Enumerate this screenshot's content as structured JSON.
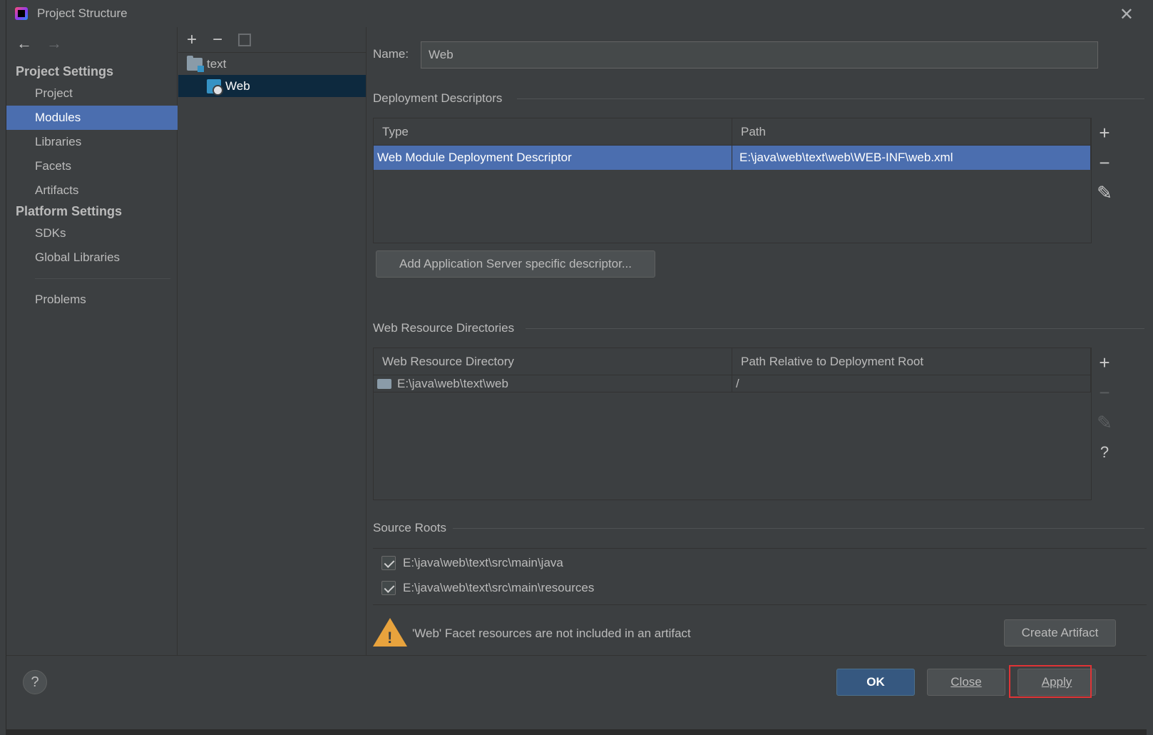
{
  "window": {
    "title": "Project Structure",
    "close_glyph": "✕"
  },
  "nav": {
    "back_glyph": "←",
    "forward_glyph": "→"
  },
  "sidebar": {
    "project_settings_header": "Project Settings",
    "project_items": [
      "Project",
      "Modules",
      "Libraries",
      "Facets",
      "Artifacts"
    ],
    "selected": "Modules",
    "platform_settings_header": "Platform Settings",
    "platform_items": [
      "SDKs",
      "Global Libraries"
    ],
    "problems": "Problems"
  },
  "modules_pane": {
    "toolbar": {
      "add": "+",
      "remove": "−"
    },
    "tree": [
      {
        "label": "text",
        "icon": "folder-module-icon"
      },
      {
        "label": "Web",
        "icon": "web-facet-icon",
        "selected": true
      }
    ]
  },
  "main": {
    "name_label": "Name:",
    "name_value": "Web",
    "deployment_descriptors": {
      "title": "Deployment Descriptors",
      "columns": [
        "Type",
        "Path"
      ],
      "rows": [
        {
          "type": "Web Module Deployment Descriptor",
          "path": "E:\\java\\web\\text\\web\\WEB-INF\\web.xml"
        }
      ],
      "add_server_button": "Add Application Server specific descriptor..."
    },
    "web_resource_directories": {
      "title": "Web Resource Directories",
      "columns": [
        "Web Resource Directory",
        "Path Relative to Deployment Root"
      ],
      "rows": [
        {
          "dir": "E:\\java\\web\\text\\web",
          "relative": "/"
        }
      ]
    },
    "source_roots": {
      "title": "Source Roots",
      "items": [
        {
          "path": "E:\\java\\web\\text\\src\\main\\java",
          "checked": true
        },
        {
          "path": "E:\\java\\web\\text\\src\\main\\resources",
          "checked": true
        }
      ]
    },
    "warning": {
      "text": "'Web' Facet resources are not included in an artifact",
      "button": "Create Artifact"
    }
  },
  "tools": {
    "add": "+",
    "remove": "−",
    "edit": "✎",
    "help": "?"
  },
  "footer": {
    "help": "?",
    "ok": "OK",
    "close": "Close",
    "apply": "Apply"
  },
  "colors": {
    "selection": "#4b6eaf",
    "tree_selection": "#0d293e",
    "warning": "#e8a33d",
    "highlight_box": "#e03436",
    "primary_button": "#365880"
  }
}
